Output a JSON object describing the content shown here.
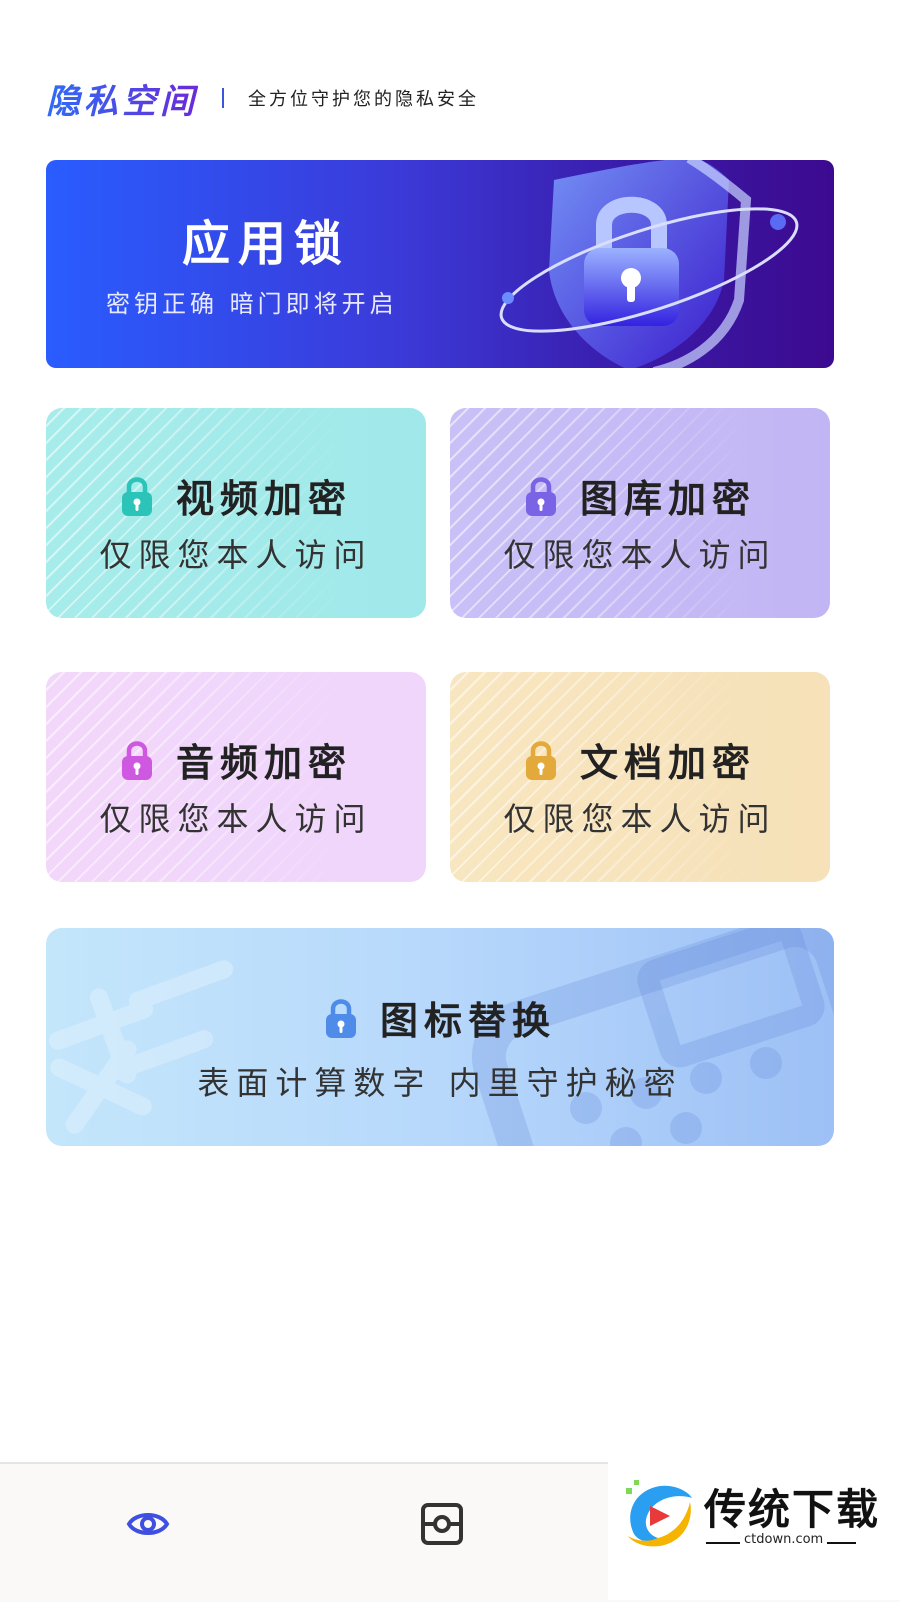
{
  "header": {
    "brand": "隐私空间",
    "tagline": "全方位守护您的隐私安全"
  },
  "banner": {
    "title": "应用锁",
    "subtitle": "密钥正确 暗门即将开启"
  },
  "cards": [
    {
      "title": "视频加密",
      "subtitle": "仅限您本人访问",
      "accent": "#2cc3b8",
      "icon": "lock-icon"
    },
    {
      "title": "图库加密",
      "subtitle": "仅限您本人访问",
      "accent": "#7b63e6",
      "icon": "lock-icon"
    },
    {
      "title": "音频加密",
      "subtitle": "仅限您本人访问",
      "accent": "#cf58e0",
      "icon": "lock-icon"
    },
    {
      "title": "文档加密",
      "subtitle": "仅限您本人访问",
      "accent": "#e3a93a",
      "icon": "lock-icon"
    }
  ],
  "icon_replace": {
    "title": "图标替换",
    "subtitle": "表面计算数字 内里守护秘密",
    "accent": "#4f8be8",
    "icon": "lock-icon"
  },
  "bottom_nav": {
    "items": [
      {
        "icon": "eye-icon",
        "accent": "#3f4fe0"
      },
      {
        "icon": "camera-box-icon",
        "accent": "#333333"
      }
    ]
  },
  "watermark": {
    "text": "传统下载",
    "url": "ctdown.com"
  }
}
